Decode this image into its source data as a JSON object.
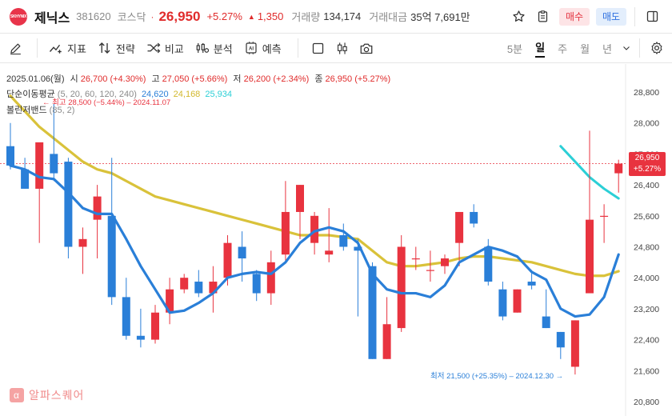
{
  "header": {
    "logo_text": "SKHYNIX",
    "name": "제닉스",
    "code": "381620",
    "market": "코스닥",
    "dot": "·",
    "price": "26,950",
    "change_pct": "+5.27%",
    "change_abs": "1,350",
    "volume_label": "거래량",
    "volume": "134,174",
    "amount_label": "거래대금",
    "amount": "35억 7,691만",
    "buy_label": "매수",
    "sell_label": "매도"
  },
  "toolbar": {
    "tools": [
      "지표",
      "전략",
      "비교",
      "분석",
      "예측"
    ],
    "periods": [
      "5분",
      "일",
      "주",
      "월",
      "년"
    ],
    "active_period": "일"
  },
  "legend": {
    "date": "2025.01.06(월)",
    "open_label": "시",
    "open": "26,700",
    "open_pct": "(+4.30%)",
    "high_label": "고",
    "high": "27,050",
    "high_pct": "(+5.66%)",
    "low_label": "저",
    "low": "26,200",
    "low_pct": "(+2.34%)",
    "close_label": "종",
    "close": "26,950",
    "close_pct": "(+5.27%)",
    "ma_label": "단순이동평균",
    "ma_params": "(5, 20, 60, 120, 240)",
    "ma5": "24,620",
    "ma20": "24,168",
    "ma60": "25,934",
    "bb_label": "볼린저밴드",
    "bb_params": "(85, 2)"
  },
  "annotations": {
    "high": "최고 28,500 (−5.44%) – 2024.11.07",
    "low": "최저 21,500 (+25.35%) – 2024.12.30"
  },
  "price_badge": {
    "price": "26,950",
    "pct": "+5.27%"
  },
  "watermark": {
    "icon": "α",
    "text": "알파스퀘어"
  },
  "colors": {
    "up": "#e8333f",
    "down": "#2a7fd8",
    "ma5": "#2a7fd8",
    "ma20": "#d9c23a",
    "ma60": "#2ccfd6"
  },
  "chart_data": {
    "type": "candlestick",
    "y_ticks": [
      "28,800",
      "28,000",
      "27,200",
      "26,400",
      "25,600",
      "24,800",
      "24,000",
      "23,200",
      "22,400",
      "21,600",
      "20,800"
    ],
    "ylim": [
      20800,
      28800
    ],
    "current_price": 26950,
    "candles": [
      {
        "o": 27400,
        "h": 28000,
        "l": 26800,
        "c": 26900
      },
      {
        "o": 26800,
        "h": 27100,
        "l": 26300,
        "c": 26300
      },
      {
        "o": 26300,
        "h": 27400,
        "l": 24900,
        "c": 27500
      },
      {
        "o": 27200,
        "h": 28500,
        "l": 26500,
        "c": 26700
      },
      {
        "o": 27000,
        "h": 27100,
        "l": 24500,
        "c": 24800
      },
      {
        "o": 24800,
        "h": 25300,
        "l": 24100,
        "c": 25000
      },
      {
        "o": 25500,
        "h": 26400,
        "l": 24500,
        "c": 26100
      },
      {
        "o": 25600,
        "h": 27100,
        "l": 23300,
        "c": 23500
      },
      {
        "o": 23500,
        "h": 24000,
        "l": 22400,
        "c": 22500
      },
      {
        "o": 22500,
        "h": 23200,
        "l": 22200,
        "c": 22400
      },
      {
        "o": 22400,
        "h": 23300,
        "l": 22300,
        "c": 23100
      },
      {
        "o": 23100,
        "h": 24000,
        "l": 22800,
        "c": 23700
      },
      {
        "o": 23700,
        "h": 24100,
        "l": 23600,
        "c": 24000
      },
      {
        "o": 23900,
        "h": 24200,
        "l": 23500,
        "c": 23600
      },
      {
        "o": 23600,
        "h": 24300,
        "l": 23100,
        "c": 23900
      },
      {
        "o": 24000,
        "h": 25100,
        "l": 23800,
        "c": 24900
      },
      {
        "o": 24800,
        "h": 25200,
        "l": 23900,
        "c": 24500
      },
      {
        "o": 24100,
        "h": 24200,
        "l": 23400,
        "c": 23600
      },
      {
        "o": 23600,
        "h": 24700,
        "l": 23300,
        "c": 24400
      },
      {
        "o": 24600,
        "h": 26500,
        "l": 24400,
        "c": 25700
      },
      {
        "o": 25700,
        "h": 26400,
        "l": 25000,
        "c": 26400
      },
      {
        "o": 24900,
        "h": 25700,
        "l": 24600,
        "c": 25600
      },
      {
        "o": 24600,
        "h": 25800,
        "l": 24400,
        "c": 24700
      },
      {
        "o": 25100,
        "h": 25400,
        "l": 24700,
        "c": 24800
      },
      {
        "o": 24800,
        "h": 25000,
        "l": 23000,
        "c": 24700
      },
      {
        "o": 24300,
        "h": 24400,
        "l": 21900,
        "c": 21900
      },
      {
        "o": 21900,
        "h": 23500,
        "l": 21900,
        "c": 22800
      },
      {
        "o": 22700,
        "h": 25100,
        "l": 22600,
        "c": 24800
      },
      {
        "o": 24500,
        "h": 24800,
        "l": 24200,
        "c": 24500
      },
      {
        "o": 24200,
        "h": 24700,
        "l": 23900,
        "c": 24200
      },
      {
        "o": 24300,
        "h": 24600,
        "l": 24100,
        "c": 24500
      },
      {
        "o": 24900,
        "h": 25700,
        "l": 24300,
        "c": 25700
      },
      {
        "o": 25700,
        "h": 25900,
        "l": 25300,
        "c": 25400
      },
      {
        "o": 24800,
        "h": 25000,
        "l": 23800,
        "c": 23900
      },
      {
        "o": 23700,
        "h": 23900,
        "l": 22900,
        "c": 23000
      },
      {
        "o": 23100,
        "h": 23700,
        "l": 23100,
        "c": 23700
      },
      {
        "o": 23900,
        "h": 24200,
        "l": 23700,
        "c": 23800
      },
      {
        "o": 23000,
        "h": 23700,
        "l": 22700,
        "c": 22700
      },
      {
        "o": 22600,
        "h": 22600,
        "l": 21900,
        "c": 22200
      },
      {
        "o": 21700,
        "h": 22900,
        "l": 21500,
        "c": 22900
      },
      {
        "o": 23600,
        "h": 27800,
        "l": 23600,
        "c": 25500
      },
      {
        "o": 25600,
        "h": 25900,
        "l": 24900,
        "c": 25600
      },
      {
        "o": 26700,
        "h": 27050,
        "l": 26200,
        "c": 26950
      }
    ],
    "ma5": [
      26900,
      26800,
      26600,
      26550,
      26200,
      25800,
      25650,
      25650,
      25000,
      24300,
      23700,
      23100,
      23150,
      23350,
      23600,
      24000,
      24100,
      24150,
      24100,
      24400,
      24900,
      25200,
      25300,
      25200,
      24900,
      24100,
      23700,
      23600,
      23600,
      23500,
      23800,
      24400,
      24600,
      24800,
      24700,
      24550,
      24150,
      23950,
      23200,
      23000,
      23050,
      23500,
      24600
    ],
    "ma20": [
      28700,
      28300,
      27900,
      27600,
      27300,
      27000,
      26800,
      26700,
      26500,
      26300,
      26100,
      26000,
      25900,
      25800,
      25700,
      25600,
      25500,
      25400,
      25300,
      25200,
      25100,
      25100,
      25100,
      25050,
      25000,
      24700,
      24400,
      24300,
      24300,
      24350,
      24400,
      24500,
      24550,
      24550,
      24500,
      24450,
      24400,
      24300,
      24200,
      24100,
      24050,
      24050,
      24168
    ],
    "ma60_x": [
      38,
      39,
      40,
      41,
      42
    ],
    "ma60": [
      27400,
      27000,
      26600,
      26300,
      26050
    ]
  }
}
